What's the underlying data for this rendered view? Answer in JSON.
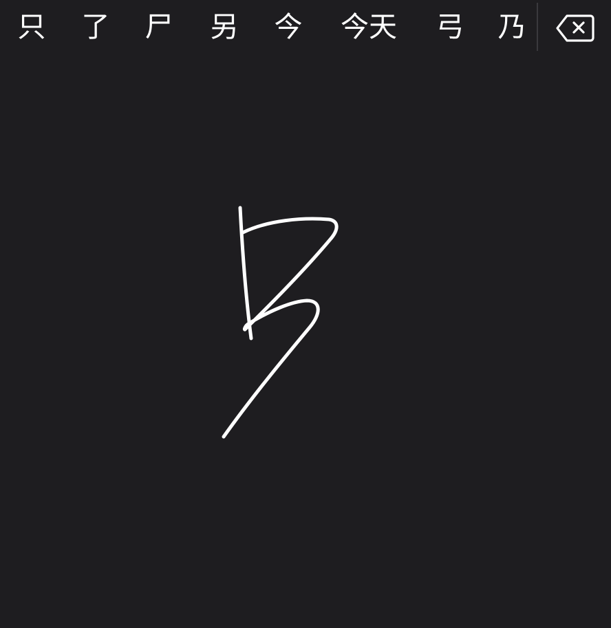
{
  "candidates": [
    {
      "text": "只"
    },
    {
      "text": "了"
    },
    {
      "text": "尸"
    },
    {
      "text": "另"
    },
    {
      "text": "今"
    },
    {
      "text": "今天"
    },
    {
      "text": "弓"
    },
    {
      "text": "乃"
    }
  ],
  "delete_key": {
    "icon": "backspace-icon"
  },
  "colors": {
    "background": "#1e1d20",
    "text": "#ffffff",
    "separator": "#3a393d",
    "stroke": "#ffffff"
  }
}
